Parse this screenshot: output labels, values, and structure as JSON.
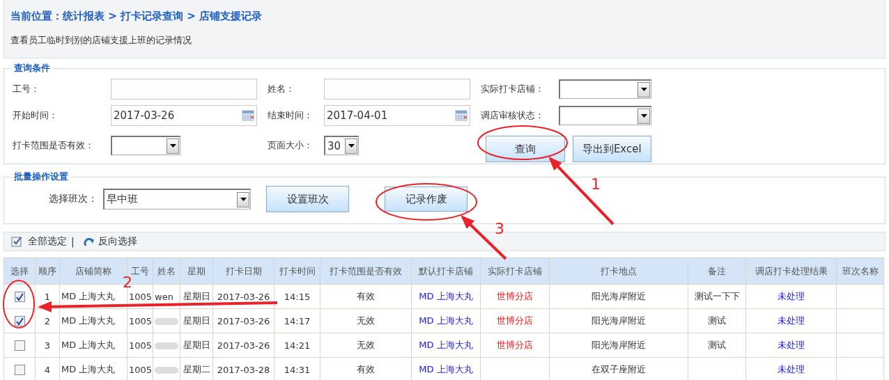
{
  "breadcrumb": "当前位置：统计报表 > 打卡记录查询 > 店铺支援记录",
  "description": "查看员工临时到别的店铺支援上班的记录情况",
  "query": {
    "legend": "查询条件",
    "fields": [
      {
        "kind": "text",
        "label": "工号："
      },
      {
        "kind": "text",
        "label": "姓名："
      },
      {
        "kind": "select",
        "label": "实际打卡店铺："
      },
      {
        "kind": "date",
        "label": "开始时间：",
        "value": "2017-03-26"
      },
      {
        "kind": "date",
        "label": "结束时间：",
        "value": "2017-04-01"
      },
      {
        "kind": "select",
        "label": "调店审核状态："
      },
      {
        "kind": "select",
        "label": "打卡范围是否有效："
      },
      {
        "kind": "select",
        "label": "页面大小：",
        "value": "30"
      }
    ],
    "buttons": [
      "查询",
      "导出到Excel"
    ]
  },
  "batch": {
    "legend": "批量操作设置",
    "shift_label": "选择班次：",
    "shift_value": "早中班",
    "buttons": [
      "设置班次",
      "记录作废"
    ]
  },
  "toolbar": {
    "select_all": "全部选定",
    "separator": "|",
    "invert": "反向选择"
  },
  "table": {
    "columns": [
      "选择",
      "顺序",
      "店铺简称",
      "工号",
      "姓名",
      "星期",
      "打卡日期",
      "打卡时间",
      "打卡范围是否有效",
      "默认打卡店铺",
      "实际打卡店铺",
      "打卡地点",
      "备注",
      "调店打卡处理结果",
      "班次名称"
    ],
    "rows": [
      {
        "checked": true,
        "no": "1",
        "store": "MD 上海大丸",
        "id": "1005",
        "name": "wen",
        "redacted": false,
        "weekday": "星期日",
        "date": "2017-03-26",
        "time": "14:15",
        "valid": "有效",
        "default_store": "MD 上海大丸",
        "actual_store": "世博分店",
        "location": "阳光海岸附近",
        "note": "测试一下下",
        "result": "未处理"
      },
      {
        "checked": true,
        "no": "2",
        "store": "MD 上海大丸",
        "id": "1005",
        "redacted": true,
        "weekday": "星期日",
        "date": "2017-03-26",
        "time": "14:17",
        "valid": "无效",
        "default_store": "MD 上海大丸",
        "actual_store": "世博分店",
        "location": "阳光海岸附近",
        "note": "测试",
        "result": "未处理"
      },
      {
        "checked": false,
        "no": "3",
        "store": "MD 上海大丸",
        "id": "1005",
        "redacted": true,
        "weekday": "星期日",
        "date": "2017-03-26",
        "time": "14:21",
        "valid": "无效",
        "default_store": "MD 上海大丸",
        "actual_store": "世博分店",
        "location": "阳光海岸附近",
        "note": "测试",
        "result": "未处理"
      },
      {
        "checked": false,
        "no": "4",
        "store": "MD 上海大丸",
        "id": "1005",
        "redacted": true,
        "weekday": "星期二",
        "date": "2017-03-28",
        "time": "14:31",
        "valid": "有效",
        "default_store": "MD 上海大丸",
        "location": "在双子座附近",
        "result": "未处理"
      }
    ]
  },
  "annotations": [
    "1",
    "2",
    "3"
  ]
}
